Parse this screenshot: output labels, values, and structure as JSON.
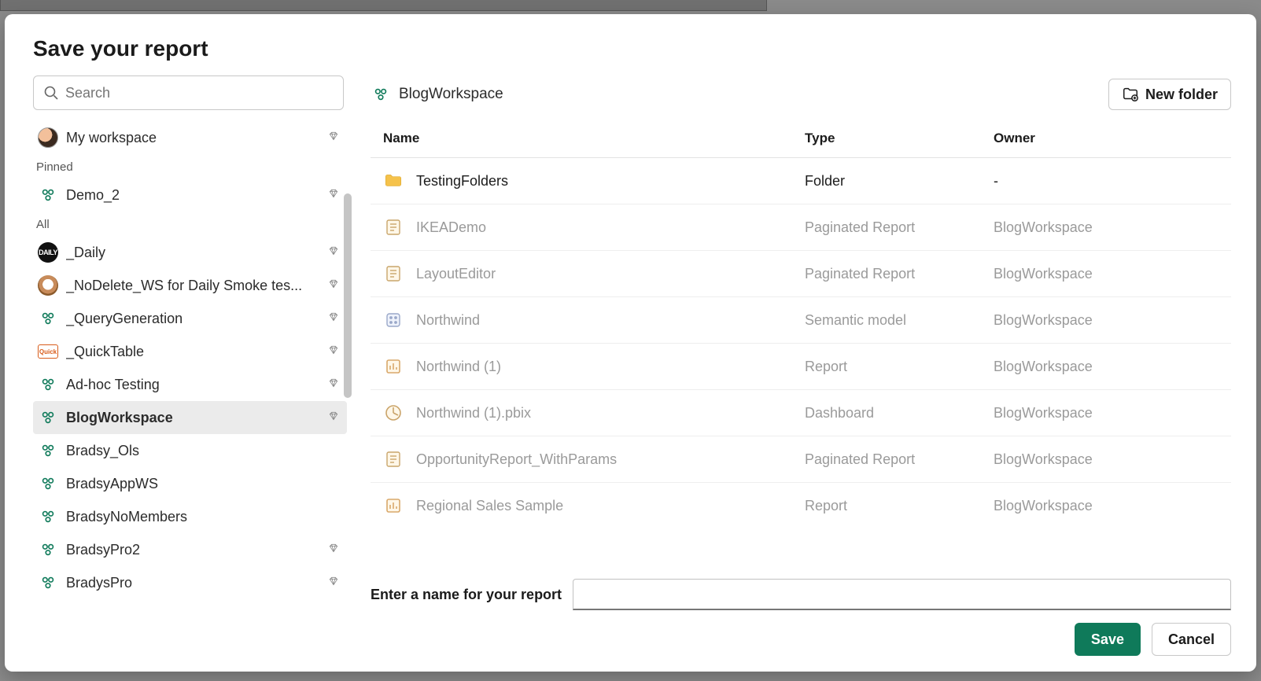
{
  "dialog": {
    "title": "Save your report",
    "search_placeholder": "Search",
    "new_folder_label": "New folder",
    "name_prompt": "Enter a name for your report",
    "report_name_value": "",
    "save_label": "Save",
    "cancel_label": "Cancel"
  },
  "breadcrumb": {
    "current": "BlogWorkspace"
  },
  "sidebar": {
    "my_workspace_label": "My workspace",
    "section_pinned": "Pinned",
    "section_all": "All",
    "pinned": [
      {
        "label": "Demo_2",
        "icon": "people",
        "premium": true
      }
    ],
    "all": [
      {
        "label": "_Daily",
        "icon": "dark-badge",
        "badge_text": "DAILY",
        "premium": true
      },
      {
        "label": "_NoDelete_WS for Daily Smoke tes...",
        "icon": "dog",
        "premium": true
      },
      {
        "label": "_QueryGeneration",
        "icon": "people",
        "premium": true
      },
      {
        "label": "_QuickTable",
        "icon": "quick",
        "premium": true
      },
      {
        "label": "Ad-hoc Testing",
        "icon": "people",
        "premium": true
      },
      {
        "label": "BlogWorkspace",
        "icon": "people",
        "premium": true,
        "selected": true
      },
      {
        "label": "Bradsy_Ols",
        "icon": "people",
        "premium": false
      },
      {
        "label": "BradsyAppWS",
        "icon": "people",
        "premium": false
      },
      {
        "label": "BradsyNoMembers",
        "icon": "people",
        "premium": false
      },
      {
        "label": "BradsyPro2",
        "icon": "people",
        "premium": true
      },
      {
        "label": "BradysPro",
        "icon": "people",
        "premium": true
      }
    ]
  },
  "table": {
    "columns": {
      "name": "Name",
      "type": "Type",
      "owner": "Owner"
    },
    "rows": [
      {
        "name": "TestingFolders",
        "type": "Folder",
        "owner": "-",
        "icon": "folder",
        "enabled": true
      },
      {
        "name": "IKEADemo",
        "type": "Paginated Report",
        "owner": "BlogWorkspace",
        "icon": "paginated",
        "enabled": false
      },
      {
        "name": "LayoutEditor",
        "type": "Paginated Report",
        "owner": "BlogWorkspace",
        "icon": "paginated",
        "enabled": false
      },
      {
        "name": "Northwind",
        "type": "Semantic model",
        "owner": "BlogWorkspace",
        "icon": "model",
        "enabled": false
      },
      {
        "name": "Northwind (1)",
        "type": "Report",
        "owner": "BlogWorkspace",
        "icon": "report",
        "enabled": false
      },
      {
        "name": "Northwind (1).pbix",
        "type": "Dashboard",
        "owner": "BlogWorkspace",
        "icon": "dashboard",
        "enabled": false
      },
      {
        "name": "OpportunityReport_WithParams",
        "type": "Paginated Report",
        "owner": "BlogWorkspace",
        "icon": "paginated",
        "enabled": false
      },
      {
        "name": "Regional Sales Sample",
        "type": "Report",
        "owner": "BlogWorkspace",
        "icon": "report",
        "enabled": false
      }
    ]
  }
}
